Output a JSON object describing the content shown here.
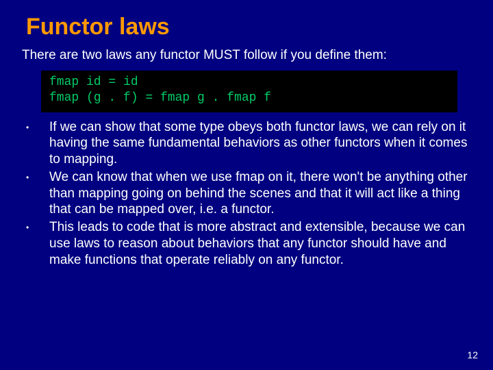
{
  "title": "Functor laws",
  "intro": "There are two laws any functor MUST follow if you define them:",
  "code": "fmap id = id\nfmap (g . f) = fmap g . fmap f",
  "bullets": [
    "If we can show that some type obeys both functor laws, we can rely on it having the same fundamental behaviors as other functors when it comes to mapping.",
    "We can know that when we use fmap on it, there won't be anything other than mapping going on behind the scenes and that it will act like a thing that can be mapped over, i.e. a functor.",
    "This leads to code that is more abstract and extensible, because we can use laws to reason about behaviors that any functor should have and make functions that operate reliably on any functor."
  ],
  "page_number": "12"
}
